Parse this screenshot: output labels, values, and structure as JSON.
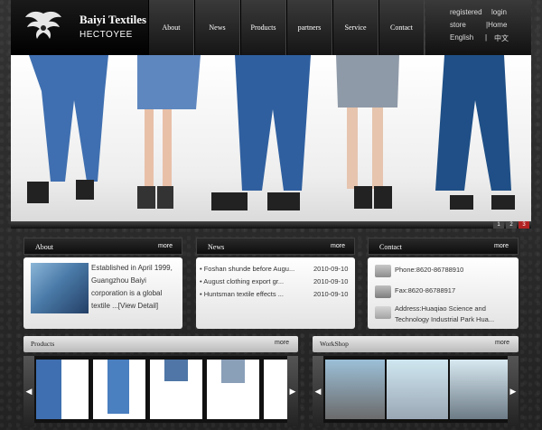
{
  "brand": {
    "name": "Baiyi Textiles",
    "sub": "HECTOYEE"
  },
  "nav": [
    "About",
    "News",
    "Products",
    "partners",
    "Service",
    "Contact"
  ],
  "topright": {
    "registered": "registered",
    "login": "login",
    "store": "store",
    "home": "|Home",
    "english": "English",
    "sep": "|",
    "chinese": "中文"
  },
  "banner": {
    "pager": [
      "1",
      "2",
      "3"
    ]
  },
  "about": {
    "title": "About",
    "more": "more",
    "text": "Established in April 1999, Guangzhou Baiyi corporation is a global textile ...[View Detail]"
  },
  "news": {
    "title": "News",
    "more": "more",
    "items": [
      {
        "text": "• Foshan shunde before Augu...",
        "date": "2010-09-10"
      },
      {
        "text": "• August clothing export gr...",
        "date": "2010-09-10"
      },
      {
        "text": "• Huntsman textile effects ...",
        "date": "2010-09-10"
      }
    ]
  },
  "contact": {
    "title": "Contact",
    "more": "more",
    "phone": "Phone:8620-86788910",
    "fax": "Fax:8620-86788917",
    "address": "Address:Huaqiao Science and Technology Industrial Park Hua..."
  },
  "products": {
    "title": "Products",
    "more": "more"
  },
  "workshop": {
    "title": "WorkShop",
    "more": "more"
  },
  "icons": {
    "prev": "◀",
    "next": "▶"
  },
  "colors": {
    "accent": "#b22222",
    "dark": "#111111"
  }
}
